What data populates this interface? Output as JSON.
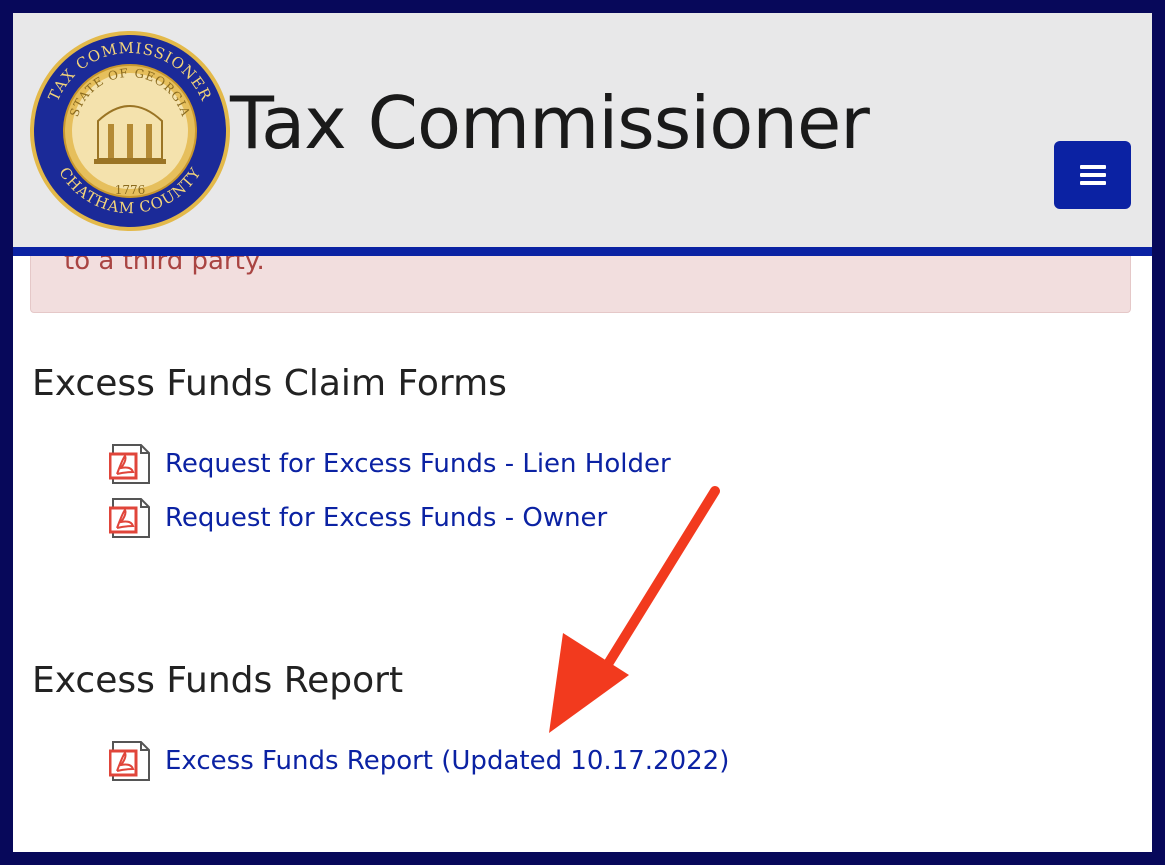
{
  "header": {
    "title": "Tax Commissioner",
    "seal": {
      "ring_top": "TAX COMMISSIONER",
      "ring_bottom": "CHATHAM COUNTY",
      "inner_top": "STATE OF GEORGIA",
      "year": "1776"
    },
    "menu_icon": "hamburger-icon"
  },
  "alert": {
    "text": "to a third party."
  },
  "sections": [
    {
      "heading": "Excess Funds Claim Forms",
      "links": [
        {
          "label": "Request for Excess Funds - Lien Holder",
          "icon": "pdf-icon"
        },
        {
          "label": "Request for Excess Funds - Owner",
          "icon": "pdf-icon"
        }
      ]
    },
    {
      "heading": "Excess Funds Report",
      "links": [
        {
          "label": "Excess Funds Report (Updated 10.17.2022)",
          "icon": "pdf-icon"
        }
      ]
    }
  ],
  "annotation": {
    "arrow_color": "#f23a1e"
  },
  "colors": {
    "brand_blue": "#0b22a3",
    "frame_navy": "#07085a",
    "header_gray": "#e8e8e9",
    "alert_bg": "#f2dede",
    "alert_text": "#a94442"
  }
}
